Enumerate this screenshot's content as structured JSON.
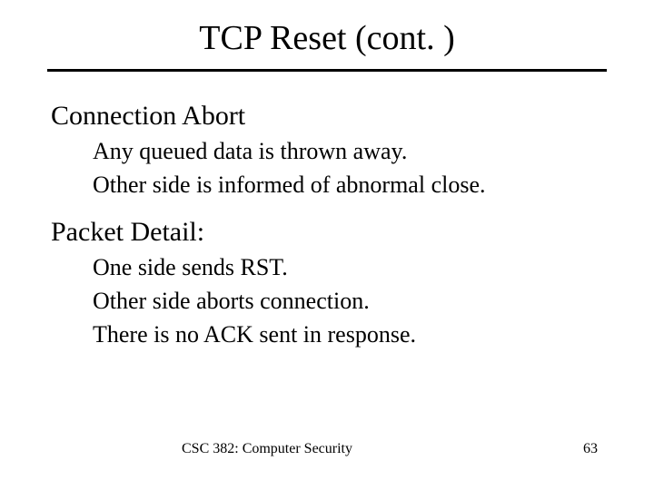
{
  "title": "TCP Reset (cont. )",
  "section1": {
    "heading": "Connection Abort",
    "items": [
      "Any queued data is thrown away.",
      "Other side is informed of abnormal close."
    ]
  },
  "section2": {
    "heading": "Packet Detail:",
    "items": [
      "One side sends RST.",
      "Other side aborts connection.",
      "There is no ACK sent in response."
    ]
  },
  "footer": {
    "course": "CSC 382: Computer Security",
    "page": "63"
  }
}
